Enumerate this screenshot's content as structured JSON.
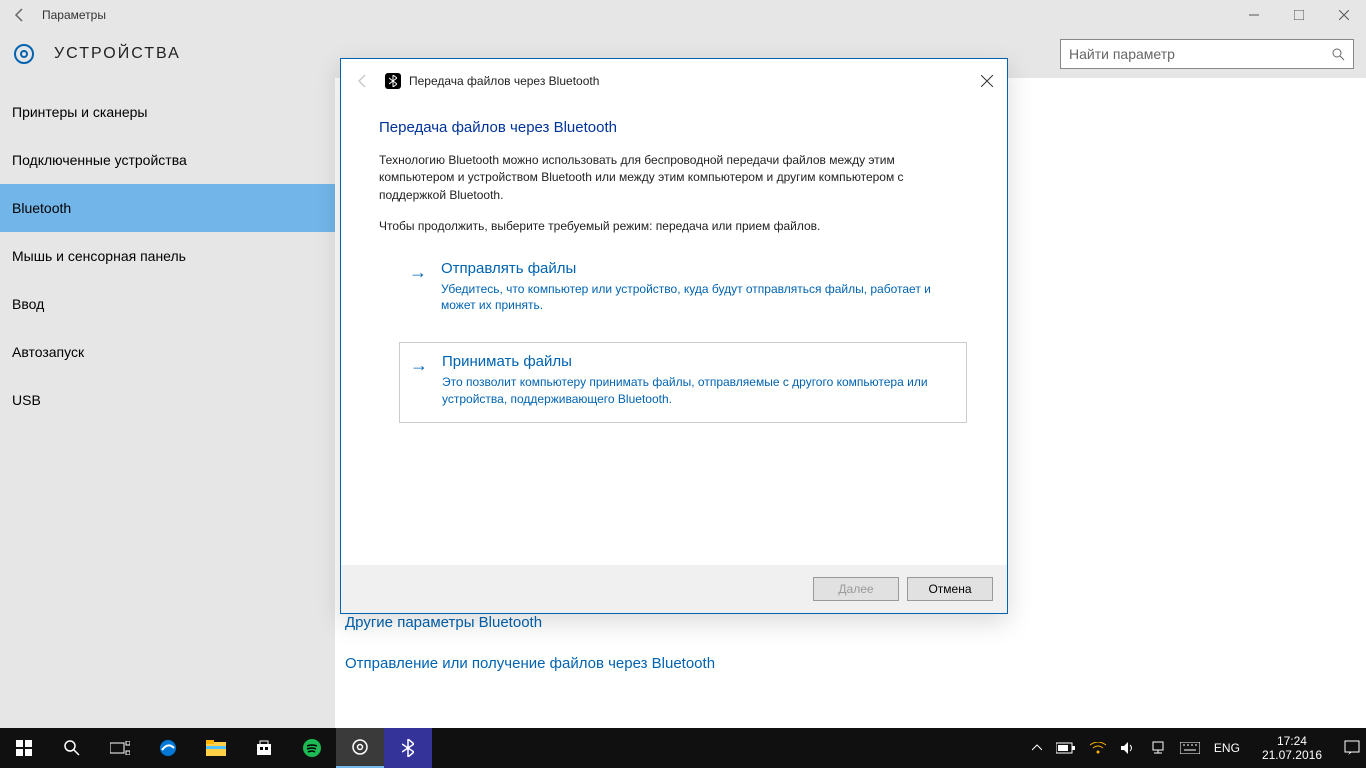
{
  "window": {
    "title": "Параметры",
    "category": "УСТРОЙСТВА",
    "search_placeholder": "Найти параметр"
  },
  "sidebar": {
    "items": [
      {
        "label": "Принтеры и сканеры"
      },
      {
        "label": "Подключенные устройства"
      },
      {
        "label": "Bluetooth"
      },
      {
        "label": "Мышь и сенсорная панель"
      },
      {
        "label": "Ввод"
      },
      {
        "label": "Автозапуск"
      },
      {
        "label": "USB"
      }
    ],
    "selected_index": 2
  },
  "content": {
    "links": [
      "Другие параметры Bluetooth",
      "Отправление или получение файлов через Bluetooth"
    ]
  },
  "dialog": {
    "title": "Передача файлов через Bluetooth",
    "heading": "Передача файлов через Bluetooth",
    "para1": "Технологию Bluetooth можно использовать для беспроводной передачи файлов между этим компьютером и устройством Bluetooth или между этим компьютером и другим компьютером с поддержкой Bluetooth.",
    "para2": "Чтобы продолжить, выберите требуемый режим: передача или прием файлов.",
    "options": [
      {
        "title": "Отправлять файлы",
        "desc": "Убедитесь, что компьютер или устройство, куда будут отправляться файлы, работает и может их принять."
      },
      {
        "title": "Принимать файлы",
        "desc": "Это позволит компьютеру принимать файлы, отправляемые с другого компьютера или устройства, поддерживающего Bluetooth."
      }
    ],
    "next_label": "Далее",
    "cancel_label": "Отмена"
  },
  "taskbar": {
    "lang": "ENG",
    "time": "17:24",
    "date": "21.07.2016"
  }
}
